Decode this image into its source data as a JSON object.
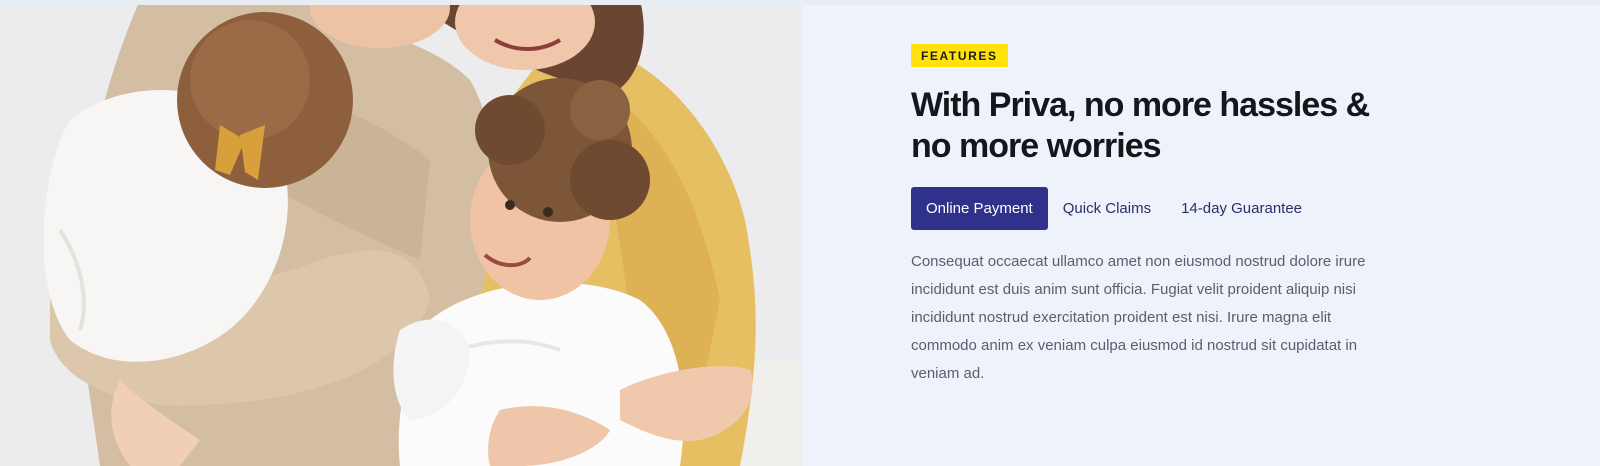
{
  "hero_image": {
    "subject": "family-hug-photo"
  },
  "features": {
    "badge": "FEATURES",
    "title_line1": "With Priva, no more hassles &",
    "title_line2": "no more worries",
    "tabs": [
      {
        "label": "Online Payment",
        "active": true
      },
      {
        "label": "Quick Claims",
        "active": false
      },
      {
        "label": "14-day Guarantee",
        "active": false
      }
    ],
    "paragraph": "Consequat occaecat ullamco amet non eiusmod nostrud dolore irure incididunt est duis anim sunt officia. Fugiat velit proident aliquip nisi incididunt nostrud exercitation proident est nisi. Irure magna elit commodo anim ex veniam culpa eiusmod id nostrud sit cupidatat in veniam ad."
  },
  "colors": {
    "background": "#eef3fb",
    "badge": "#ffe20a",
    "active_tab": "#2f318a",
    "title": "#16161a",
    "body_text": "#595e6d"
  }
}
